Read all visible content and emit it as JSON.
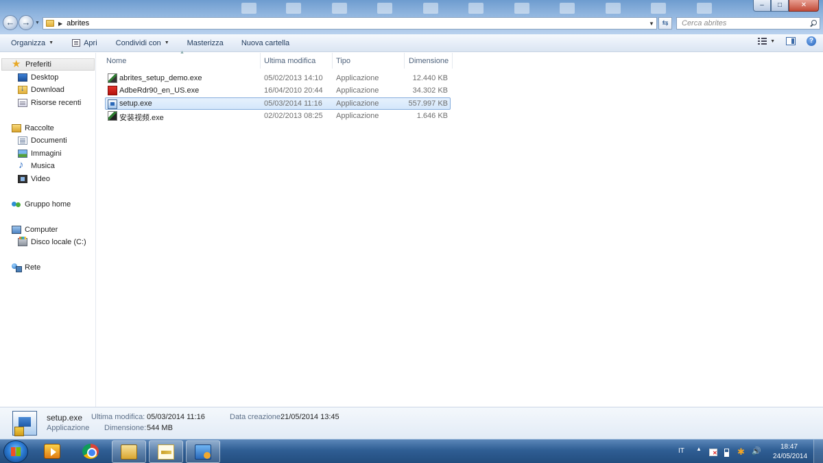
{
  "window": {
    "address": {
      "path": "abrites"
    },
    "search": {
      "placeholder": "Cerca abrites"
    },
    "controls": {
      "minimize": "–",
      "maximize": "□",
      "close": "✕"
    }
  },
  "toolbar": {
    "organize_label": "Organizza",
    "open_label": "Apri",
    "share_label": "Condividi con",
    "burn_label": "Masterizza",
    "new_folder_label": "Nuova cartella"
  },
  "sidebar": {
    "items": [
      {
        "label": "Preferiti",
        "icon": "star-icon"
      },
      {
        "label": "Desktop",
        "icon": "desktop-icon"
      },
      {
        "label": "Download",
        "icon": "downloads-folder-icon"
      },
      {
        "label": "Risorse recenti",
        "icon": "recent-places-icon"
      },
      {
        "label": "Raccolte",
        "icon": "libraries-icon"
      },
      {
        "label": "Documenti",
        "icon": "documents-icon"
      },
      {
        "label": "Immagini",
        "icon": "pictures-icon"
      },
      {
        "label": "Musica",
        "icon": "music-icon"
      },
      {
        "label": "Video",
        "icon": "video-icon"
      },
      {
        "label": "Gruppo home",
        "icon": "homegroup-icon"
      },
      {
        "label": "Computer",
        "icon": "computer-icon"
      },
      {
        "label": "Disco locale (C:)",
        "icon": "local-disk-icon"
      },
      {
        "label": "Rete",
        "icon": "network-icon"
      }
    ]
  },
  "table": {
    "columns": [
      "Nome",
      "Ultima modifica",
      "Tipo",
      "Dimensione"
    ],
    "rows": [
      {
        "name": "abrites_setup_demo.exe",
        "modified": "05/02/2013 14:10",
        "type": "Applicazione",
        "size": "12.440 KB",
        "icon": "abrites-app-icon"
      },
      {
        "name": "AdbeRdr90_en_US.exe",
        "modified": "16/04/2010 20:44",
        "type": "Applicazione",
        "size": "34.302 KB",
        "icon": "adobe-reader-icon"
      },
      {
        "name": "setup.exe",
        "modified": "05/03/2014 11:16",
        "type": "Applicazione",
        "size": "557.997 KB",
        "icon": "setup-icon"
      },
      {
        "name": "安装视频.exe",
        "modified": "02/02/2013 08:25",
        "type": "Applicazione",
        "size": "1.646 KB",
        "icon": "video-app-icon"
      }
    ]
  },
  "details": {
    "filename": "setup.exe",
    "type": "Applicazione",
    "modified_label": "Ultima modifica:",
    "modified_value": "05/03/2014 11:16",
    "size_label": "Dimensione:",
    "size_value": "544 MB",
    "created_label": "Data creazione:",
    "created_value": "21/05/2014 13:45"
  },
  "taskbar": {
    "language": "IT",
    "time": "18:47",
    "date": "24/05/2014"
  },
  "colors": {
    "selection": "#cce4fb",
    "taskbar": "#2f5e94",
    "accent": "#3b6aa8"
  }
}
